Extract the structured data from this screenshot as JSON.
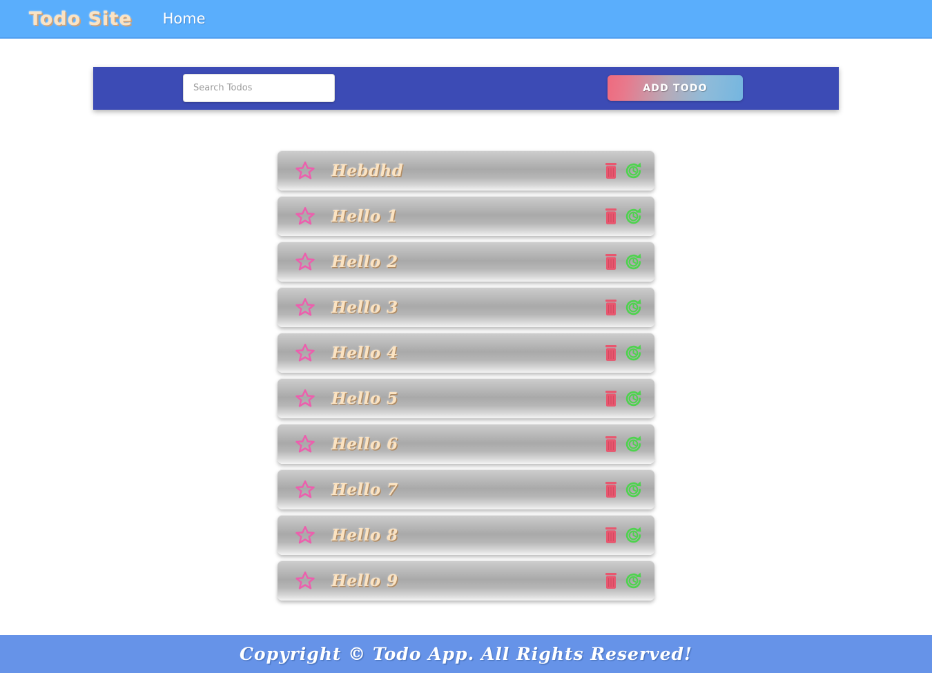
{
  "header": {
    "brand": "Todo Site",
    "nav": [
      {
        "label": "Home",
        "name": "nav-home"
      }
    ],
    "background_color": "#5aaefc"
  },
  "toolbar": {
    "background_color": "#3c4bb5",
    "search": {
      "placeholder": "Search Todos",
      "value": ""
    },
    "add_button": {
      "label": "ADD TODO",
      "gradient_from": "#ef6a7e",
      "gradient_to": "#74b6e0"
    }
  },
  "todos": [
    {
      "label": "Hebdhd",
      "star_icon": "star-icon",
      "delete_icon": "trash-icon",
      "restore_icon": "restore-icon"
    },
    {
      "label": "Hello 1",
      "star_icon": "star-icon",
      "delete_icon": "trash-icon",
      "restore_icon": "restore-icon"
    },
    {
      "label": "Hello 2",
      "star_icon": "star-icon",
      "delete_icon": "trash-icon",
      "restore_icon": "restore-icon"
    },
    {
      "label": "Hello 3",
      "star_icon": "star-icon",
      "delete_icon": "trash-icon",
      "restore_icon": "restore-icon"
    },
    {
      "label": "Hello 4",
      "star_icon": "star-icon",
      "delete_icon": "trash-icon",
      "restore_icon": "restore-icon"
    },
    {
      "label": "Hello 5",
      "star_icon": "star-icon",
      "delete_icon": "trash-icon",
      "restore_icon": "restore-icon"
    },
    {
      "label": "Hello 6",
      "star_icon": "star-icon",
      "delete_icon": "trash-icon",
      "restore_icon": "restore-icon"
    },
    {
      "label": "Hello 7",
      "star_icon": "star-icon",
      "delete_icon": "trash-icon",
      "restore_icon": "restore-icon"
    },
    {
      "label": "Hello 8",
      "star_icon": "star-icon",
      "delete_icon": "trash-icon",
      "restore_icon": "restore-icon"
    },
    {
      "label": "Hello 9",
      "star_icon": "star-icon",
      "delete_icon": "trash-icon",
      "restore_icon": "restore-icon"
    }
  ],
  "colors": {
    "star": "#ec5fad",
    "trash": "#e8576f",
    "restore": "#4ed34e",
    "todo_text": "#fbe3c2"
  },
  "footer": {
    "text": "Copyright © Todo App. All Rights Reserved!",
    "background_color": "#6693e8"
  }
}
